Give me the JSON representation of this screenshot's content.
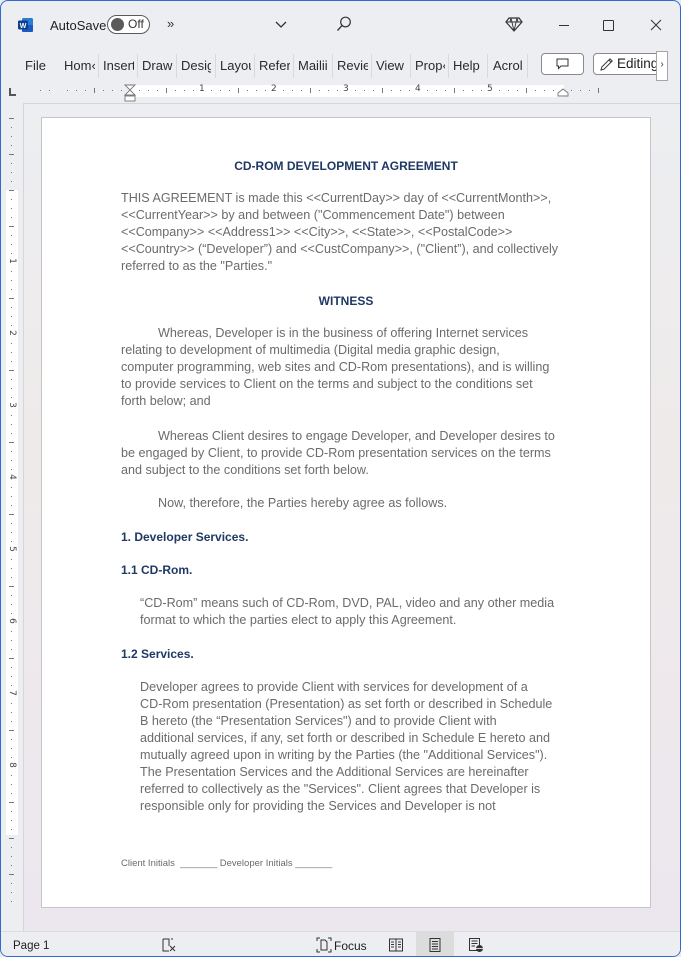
{
  "titlebar": {
    "autosave_label": "AutoSave",
    "autosave_state": "Off",
    "overflow_label": "»"
  },
  "ribbon": {
    "tabs": [
      "File",
      "Home",
      "Insert",
      "Draw",
      "Design",
      "Layout",
      "References",
      "Mailings",
      "Review",
      "View",
      "Properties",
      "Help",
      "Acrobat"
    ],
    "tabs_visible": [
      "File",
      "Hom‹",
      "Insert",
      "Draw",
      "Desig",
      "Layou",
      "Refer",
      "Mailii",
      "Revie",
      "View",
      "Prop‹",
      "Help",
      "Acrol"
    ],
    "editing_label": "Editing",
    "scroll_label": "›"
  },
  "ruler": {
    "h_numbers": [
      "1",
      "2",
      "3",
      "4",
      "5"
    ],
    "v_numbers": [
      "1",
      "2",
      "3",
      "4",
      "5",
      "6",
      "7",
      "8"
    ]
  },
  "document": {
    "title": "CD-ROM DEVELOPMENT AGREEMENT",
    "intro_lines": [
      "THIS AGREEMENT is made this <<CurrentDay>> day of <<CurrentMonth>>,",
      "<<CurrentYear>> by and between (\"Commencement Date\") between",
      "<<Company>> <<Address1>> <<City>>, <<State>>, <<PostalCode>>",
      "<<Country>> (“Developer”) and <<CustCompany>>, (\"Client”), and collectively",
      "referred to as the \"Parties.\""
    ],
    "witness_heading": "WITNESS",
    "whereas1_lines": [
      "Whereas, Developer is in the business of offering Internet services",
      "relating to development of multimedia (Digital media graphic design,",
      "computer programming, web sites and CD-Rom presentations), and is willing",
      "to provide services to Client on the terms and subject to the conditions set",
      "forth below; and"
    ],
    "whereas2_lines": [
      "Whereas Client desires to engage Developer, and Developer desires to",
      "be engaged by Client, to provide CD-Rom presentation services on the terms",
      "and subject to the conditions set forth below."
    ],
    "now_therefore": "Now, therefore, the Parties hereby agree as follows.",
    "section1_heading": "1. Developer Services.",
    "section11_heading": "1.1 CD-Rom.",
    "section11_lines": [
      "“CD-Rom” means such of CD-Rom, DVD, PAL, video and any other media",
      "format to which the parties elect to apply this Agreement."
    ],
    "section12_heading": "1.2 Services.",
    "section12_lines": [
      "Developer agrees  to provide Client with services for development of a",
      "CD-Rom presentation (Presentation) as set forth or described in Schedule",
      "B hereto (the “Presentation Services\") and to provide Client with",
      "additional services, if any, set forth or described in Schedule E hereto and",
      "mutually agreed upon in writing by the Parties (the \"Additional Services\").",
      "The Presentation Services and the Additional Services are hereinafter",
      "referred to collectively as the \"Services\". Client agrees that Developer is",
      "responsible only for providing the Services and Developer is not"
    ],
    "footer_initials": "Client Initials  _______ Developer Initials _______"
  },
  "statusbar": {
    "page_label": "Page 1",
    "focus_label": "Focus"
  }
}
